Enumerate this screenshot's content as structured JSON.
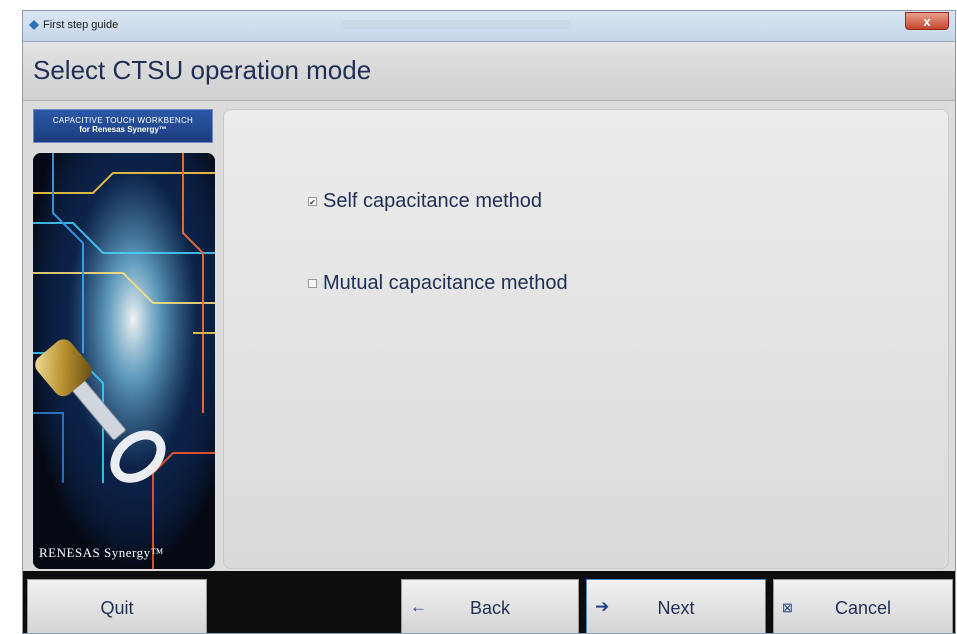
{
  "window": {
    "title": "First step guide",
    "close_label": "x"
  },
  "header": {
    "title": "Select CTSU operation mode"
  },
  "sidebar": {
    "brand_line1": "CAPACITIVE TOUCH WORKBENCH",
    "brand_line2": "for Renesas Synergy™",
    "logo_text": "RENESAS Synergy™"
  },
  "options": [
    {
      "label": "Self capacitance method",
      "checked": true
    },
    {
      "label": "Mutual capacitance method",
      "checked": false
    }
  ],
  "footer": {
    "quit_label": "Quit",
    "back_label": "Back",
    "next_label": "Next",
    "cancel_label": "Cancel"
  },
  "icons": {
    "back": "arrow-left-icon",
    "next": "arrow-right-icon",
    "cancel": "cancel-icon",
    "app": "app-icon"
  },
  "colors": {
    "heading_text": "#1f2f55",
    "brand_blue": "#1b3c7d",
    "close_red": "#c7452c"
  }
}
